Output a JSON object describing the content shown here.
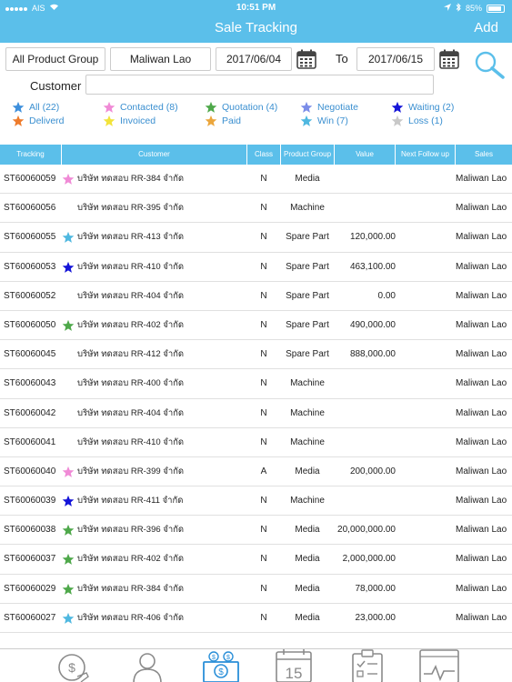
{
  "status": {
    "carrier": "AIS",
    "time": "10:51 PM",
    "battery": "85%"
  },
  "nav": {
    "title": "Sale Tracking",
    "add": "Add"
  },
  "filters": {
    "product_group": "All Product Group",
    "sales_person": "Maliwan Lao",
    "date_from": "2017/06/04",
    "to_label": "To",
    "date_to": "2017/06/15",
    "customer_label": "Customer",
    "customer_value": ""
  },
  "legend": [
    {
      "label": "All (22)",
      "color": "#3d8fdc"
    },
    {
      "label": "Contacted (8)",
      "color": "#f08ad6"
    },
    {
      "label": "Quotation (4)",
      "color": "#4ea84a"
    },
    {
      "label": "Negotiate",
      "color": "#7a8ce8"
    },
    {
      "label": "Waiting (2)",
      "color": "#1414d8"
    },
    {
      "label": "Deliverd",
      "color": "#ee7b2b"
    },
    {
      "label": "Invoiced",
      "color": "#f2e33a"
    },
    {
      "label": "Paid",
      "color": "#eba63c"
    },
    {
      "label": "Win (7)",
      "color": "#4fb8e0"
    },
    {
      "label": "Loss (1)",
      "color": "#c8c8c8"
    }
  ],
  "table": {
    "headers": [
      "Tracking",
      "Customer",
      "Class",
      "Product Group",
      "Value",
      "Next Follow up",
      "Sales"
    ],
    "rows": [
      {
        "tracking": "ST60060059",
        "star": "#f08ad6",
        "customer": "บริษัท ทดสอบ RR-384 จำกัด",
        "class": "N",
        "group": "Media",
        "value": "",
        "followup": "",
        "sales": "Maliwan Lao"
      },
      {
        "tracking": "ST60060056",
        "star": "",
        "customer": "บริษัท ทดสอบ RR-395 จำกัด",
        "class": "N",
        "group": "Machine",
        "value": "",
        "followup": "",
        "sales": "Maliwan Lao"
      },
      {
        "tracking": "ST60060055",
        "star": "#4fb8e0",
        "customer": "บริษัท ทดสอบ RR-413 จำกัด",
        "class": "N",
        "group": "Spare Part",
        "value": "120,000.00",
        "followup": "",
        "sales": "Maliwan Lao"
      },
      {
        "tracking": "ST60060053",
        "star": "#1414d8",
        "customer": "บริษัท ทดสอบ RR-410 จำกัด",
        "class": "N",
        "group": "Spare Part",
        "value": "463,100.00",
        "followup": "",
        "sales": "Maliwan Lao"
      },
      {
        "tracking": "ST60060052",
        "star": "",
        "customer": "บริษัท ทดสอบ RR-404 จำกัด",
        "class": "N",
        "group": "Spare Part",
        "value": "0.00",
        "followup": "",
        "sales": "Maliwan Lao"
      },
      {
        "tracking": "ST60060050",
        "star": "#4ea84a",
        "customer": "บริษัท ทดสอบ RR-402 จำกัด",
        "class": "N",
        "group": "Spare Part",
        "value": "490,000.00",
        "followup": "",
        "sales": "Maliwan Lao"
      },
      {
        "tracking": "ST60060045",
        "star": "",
        "customer": "บริษัท ทดสอบ RR-412 จำกัด",
        "class": "N",
        "group": "Spare Part",
        "value": "888,000.00",
        "followup": "",
        "sales": "Maliwan Lao"
      },
      {
        "tracking": "ST60060043",
        "star": "",
        "customer": "บริษัท ทดสอบ RR-400 จำกัด",
        "class": "N",
        "group": "Machine",
        "value": "",
        "followup": "",
        "sales": "Maliwan Lao"
      },
      {
        "tracking": "ST60060042",
        "star": "",
        "customer": "บริษัท ทดสอบ RR-404 จำกัด",
        "class": "N",
        "group": "Machine",
        "value": "",
        "followup": "",
        "sales": "Maliwan Lao"
      },
      {
        "tracking": "ST60060041",
        "star": "",
        "customer": "บริษัท ทดสอบ RR-410 จำกัด",
        "class": "N",
        "group": "Machine",
        "value": "",
        "followup": "",
        "sales": "Maliwan Lao"
      },
      {
        "tracking": "ST60060040",
        "star": "#f08ad6",
        "customer": "บริษัท ทดสอบ RR-399 จำกัด",
        "class": "A",
        "group": "Media",
        "value": "200,000.00",
        "followup": "",
        "sales": "Maliwan Lao"
      },
      {
        "tracking": "ST60060039",
        "star": "#1414d8",
        "customer": "บริษัท ทดสอบ RR-411 จำกัด",
        "class": "N",
        "group": "Machine",
        "value": "",
        "followup": "",
        "sales": "Maliwan Lao"
      },
      {
        "tracking": "ST60060038",
        "star": "#4ea84a",
        "customer": "บริษัท ทดสอบ RR-396 จำกัด",
        "class": "N",
        "group": "Media",
        "value": "20,000,000.00",
        "followup": "",
        "sales": "Maliwan Lao"
      },
      {
        "tracking": "ST60060037",
        "star": "#4ea84a",
        "customer": "บริษัท ทดสอบ RR-402 จำกัด",
        "class": "N",
        "group": "Media",
        "value": "2,000,000.00",
        "followup": "",
        "sales": "Maliwan Lao"
      },
      {
        "tracking": "ST60060029",
        "star": "#4ea84a",
        "customer": "บริษัท ทดสอบ RR-384 จำกัด",
        "class": "N",
        "group": "Media",
        "value": "78,000.00",
        "followup": "",
        "sales": "Maliwan Lao"
      },
      {
        "tracking": "ST60060027",
        "star": "#4fb8e0",
        "customer": "บริษัท ทดสอบ RR-406 จำกัด",
        "class": "N",
        "group": "Media",
        "value": "23,000.00",
        "followup": "",
        "sales": "Maliwan Lao"
      }
    ]
  },
  "tabbar": {
    "items": [
      {
        "name": "money-hand-icon",
        "active": false,
        "label": ""
      },
      {
        "name": "person-icon",
        "active": false,
        "label": ""
      },
      {
        "name": "sale-tracking-icon",
        "active": true,
        "label": ""
      },
      {
        "name": "calendar-icon",
        "active": false,
        "label": "15"
      },
      {
        "name": "checklist-icon",
        "active": false,
        "label": ""
      },
      {
        "name": "monitor-chart-icon",
        "active": false,
        "label": ""
      }
    ],
    "active_color": "#2a8fd8",
    "inactive_color": "#8a8a8a"
  }
}
